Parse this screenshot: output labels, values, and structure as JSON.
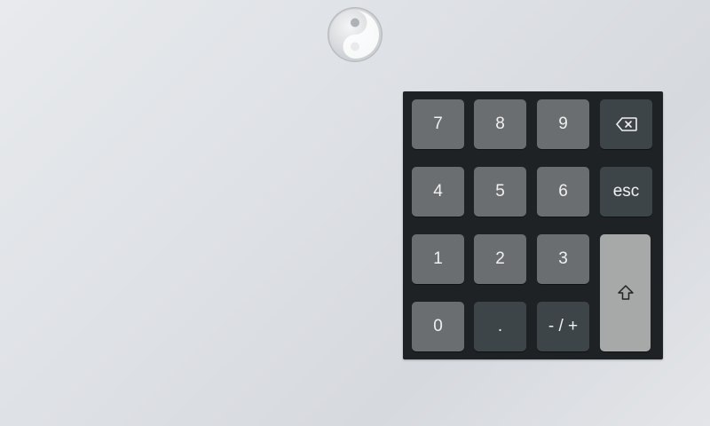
{
  "logo": {
    "icon": "yin-yang-logo-icon"
  },
  "keypad": {
    "rows": [
      [
        "7",
        "8",
        "9"
      ],
      [
        "4",
        "5",
        "6"
      ],
      [
        "1",
        "2",
        "3"
      ],
      [
        "0",
        ".",
        "- / +"
      ]
    ],
    "backspace": {
      "icon": "backspace-icon"
    },
    "esc_label": "esc",
    "shift": {
      "icon": "shift-arrow-icon"
    }
  }
}
